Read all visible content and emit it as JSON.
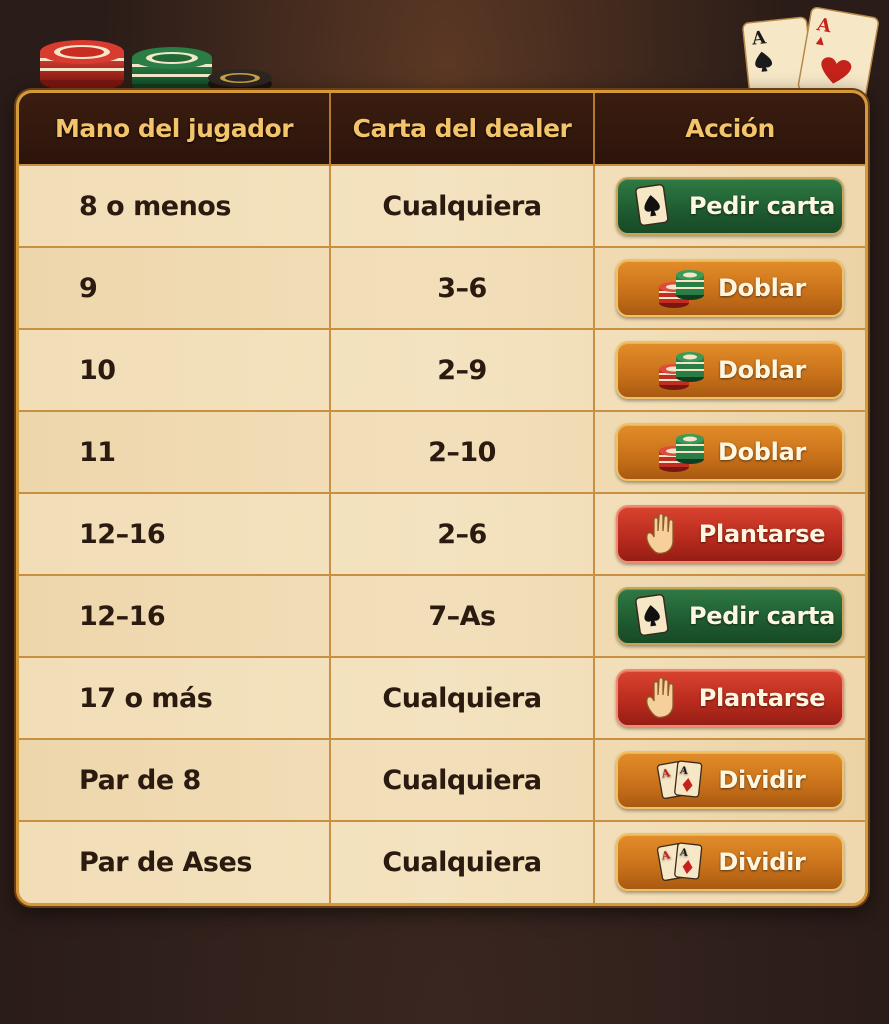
{
  "headers": {
    "player_hand": "Mano del jugador",
    "dealer_card": "Carta del dealer",
    "action": "Acción"
  },
  "rows": [
    {
      "hand": "8 o menos",
      "dealer": "Cualquiera",
      "action": "Pedir carta",
      "action_type": "hit",
      "icon": "spade-card-icon"
    },
    {
      "hand": "9",
      "dealer": "3–6",
      "action": "Doblar",
      "action_type": "double",
      "icon": "chips-icon"
    },
    {
      "hand": "10",
      "dealer": "2–9",
      "action": "Doblar",
      "action_type": "double",
      "icon": "chips-icon"
    },
    {
      "hand": "11",
      "dealer": "2–10",
      "action": "Doblar",
      "action_type": "double",
      "icon": "chips-icon"
    },
    {
      "hand": "12–16",
      "dealer": "2–6",
      "action": "Plantarse",
      "action_type": "stand",
      "icon": "hand-icon"
    },
    {
      "hand": "12–16",
      "dealer": "7–As",
      "action": "Pedir carta",
      "action_type": "hit",
      "icon": "spade-card-icon"
    },
    {
      "hand": "17 o más",
      "dealer": "Cualquiera",
      "action": "Plantarse",
      "action_type": "stand",
      "icon": "hand-icon"
    },
    {
      "hand": "Par de 8",
      "dealer": "Cualquiera",
      "action": "Dividir",
      "action_type": "split",
      "icon": "two-cards-icon"
    },
    {
      "hand": "Par de Ases",
      "dealer": "Cualquiera",
      "action": "Dividir",
      "action_type": "split",
      "icon": "two-cards-icon"
    }
  ],
  "colors": {
    "hit": "#1f5a30",
    "double": "#c8701a",
    "stand": "#b72a1d",
    "split": "#c8701a",
    "header_text": "#f3c46a",
    "frame": "#d49a3a"
  },
  "decor": {
    "top_left": "poker-chips-icon",
    "top_right": "ace-cards-icon"
  }
}
